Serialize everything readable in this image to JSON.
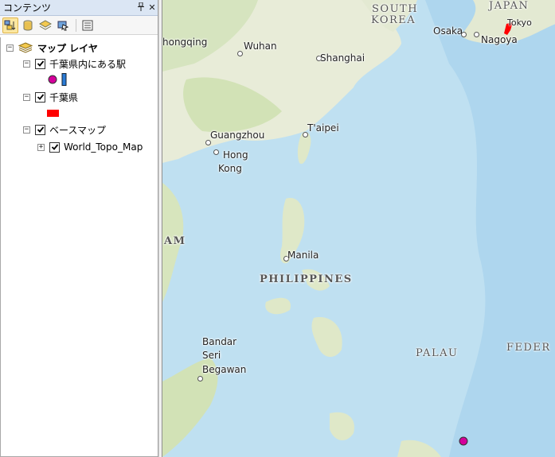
{
  "toc": {
    "title": "コンテンツ",
    "pin_glyph": "ª",
    "close_glyph": "✕",
    "toolbar": [
      {
        "icon": "list-by-drawing-order-icon",
        "active": true
      },
      {
        "icon": "list-by-source-icon",
        "active": false
      },
      {
        "icon": "list-by-visibility-icon",
        "active": false
      },
      {
        "icon": "list-by-selection-icon",
        "active": false
      },
      {
        "icon": "options-icon",
        "active": false
      }
    ],
    "layers": {
      "root": "マップ レイヤ",
      "stations": "千葉県内にある駅",
      "prefecture": "千葉県",
      "basemap": "ベースマップ",
      "topo": "World_Topo_Map"
    },
    "colors": {
      "station_symbol": "#d4009b",
      "station_line": "#2a7bd5",
      "prefecture_symbol": "#ff0000"
    }
  },
  "map": {
    "labels": {
      "south_korea_1": "SOUTH",
      "south_korea_2": "KOREA",
      "japan": "JAPAN",
      "tokyo": "Tokyo",
      "osaka": "Osaka",
      "nagoya": "Nagoya",
      "chongqing": "hongqing",
      "wuhan": "Wuhan",
      "shanghai": "Shanghai",
      "taipei": "T'aipei",
      "guangzhou": "Guangzhou",
      "hong_kong_1": "Hong",
      "hong_kong_2": "Kong",
      "vietnam": "AM",
      "manila": "Manila",
      "philippines": "PHILIPPINES",
      "palau": "PALAU",
      "micronesia": "FEDER",
      "bandar_1": "Bandar",
      "bandar_2": "Seri",
      "bandar_3": "Begawan"
    },
    "colors": {
      "sea": "#bfe0f1",
      "land": "#e9efdc",
      "forest": "#cfe0b0",
      "deep_sea": "#a9d3ec"
    }
  }
}
